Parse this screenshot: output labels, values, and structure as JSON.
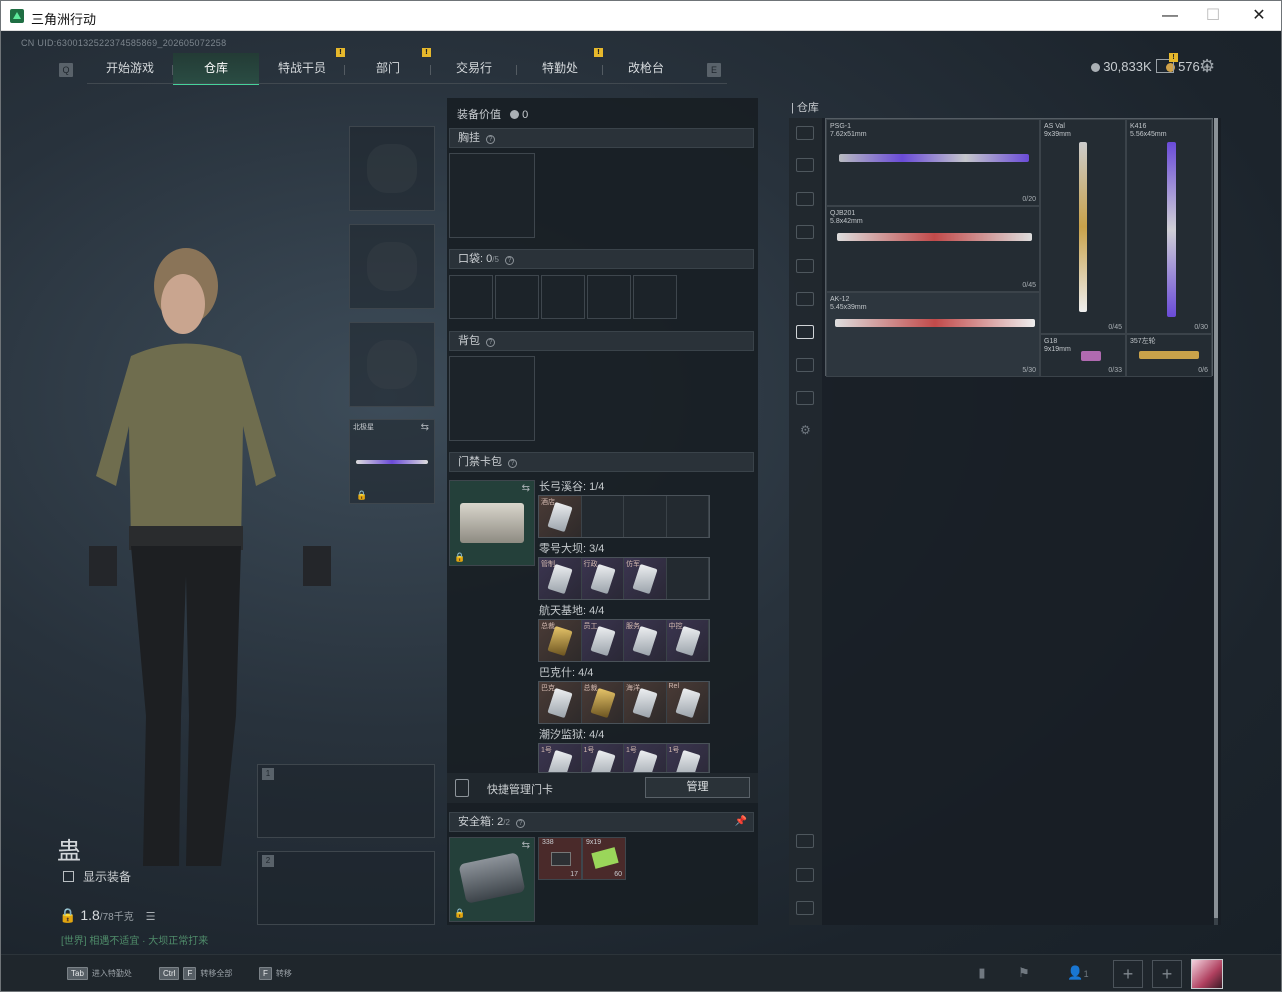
{
  "window": {
    "title": "三角洲行动",
    "minimize": "—",
    "maximize": "☐",
    "close": "✕"
  },
  "uid": "CN UID:630013252237458586​9_202605072258",
  "nav": {
    "left_key": "Q",
    "right_key": "E",
    "tabs": [
      "开始游戏",
      "仓库",
      "特战干员",
      "部门",
      "交易行",
      "特勤处",
      "改枪台"
    ],
    "active": "仓库",
    "badge": "!"
  },
  "currency": {
    "coins": "30,833K",
    "gems": "576",
    "plus": "+"
  },
  "character": {
    "name": "蛊",
    "show_equipment": "显示装备",
    "weight": "1.8",
    "weight_max": "/78千克",
    "hint": "[世界] 相遇不适宜 · 大坝正常打来"
  },
  "slots": {
    "melee_name": "北极星",
    "primary_1_num": "1",
    "primary_2_num": "2"
  },
  "middle": {
    "equip_value_label": "装备价值",
    "equip_value": "0",
    "chest_rig": "胸挂",
    "pocket_label": "口袋:",
    "pocket_count": "0",
    "pocket_max": "/5",
    "backpack": "背包",
    "keycard_pack": "门禁卡包",
    "keycard_groups": [
      {
        "label": "长弓溪谷: 1/4",
        "filled": 1,
        "tags": [
          "酒店"
        ]
      },
      {
        "label": "零号大坝: 3/4",
        "filled": 3,
        "tags": [
          "管制",
          "行政",
          "仿军"
        ]
      },
      {
        "label": "航天基地: 4/4",
        "filled": 4,
        "tags": [
          "总裁",
          "员工",
          "服务",
          "中控"
        ]
      },
      {
        "label": "巴克什: 4/4",
        "filled": 4,
        "tags": [
          "巴克",
          "总裁",
          "海洋",
          "Rel"
        ]
      },
      {
        "label": "潮汐监狱: 4/4",
        "filled": 4,
        "tags": [
          "1号",
          "1号",
          "1号",
          "1号"
        ]
      }
    ],
    "quick_manage": "快捷管理门卡",
    "manage_btn": "管理",
    "safebox_label": "安全箱:",
    "safebox_count": "2",
    "safebox_max": "/2",
    "safebox_items": [
      {
        "tag": "338",
        "count": "17"
      },
      {
        "tag": "9x19",
        "count": "60"
      }
    ]
  },
  "warehouse": {
    "title": "仓库",
    "weapons": [
      {
        "name": "PSG-1",
        "cal": "7.62x51mm",
        "ammo": "0/20",
        "color": "#6a4bd8"
      },
      {
        "name": "AS Val",
        "cal": "9x39mm",
        "ammo": "0/45",
        "color": "#c9a24a"
      },
      {
        "name": "K416",
        "cal": "5.56x45mm",
        "ammo": "0/30",
        "color": "#6a4bd8"
      },
      {
        "name": "QJB201",
        "cal": "5.8x42mm",
        "ammo": "0/45",
        "color": "#c24a4a"
      },
      {
        "name": "AK-12",
        "cal": "5.45x39mm",
        "ammo": "5/30",
        "color": "#c24a4a"
      },
      {
        "name": "G18",
        "cal": "9x19mm",
        "ammo": "0/33",
        "color": "#b06ab0"
      },
      {
        "name": "357左轮",
        "cal": "",
        "ammo": "0/6",
        "color": "#c9a24a"
      }
    ]
  },
  "bottom": {
    "hints": [
      {
        "key": "Tab",
        "label": "进入特勤处"
      },
      {
        "key": "Ctrl",
        "key2": "F",
        "label": "转移全部"
      },
      {
        "key": "F",
        "label": "转移"
      }
    ],
    "friends": "1",
    "plus": "+"
  },
  "colors": {
    "accent": "#46d39a",
    "badge": "#e6b82c"
  }
}
